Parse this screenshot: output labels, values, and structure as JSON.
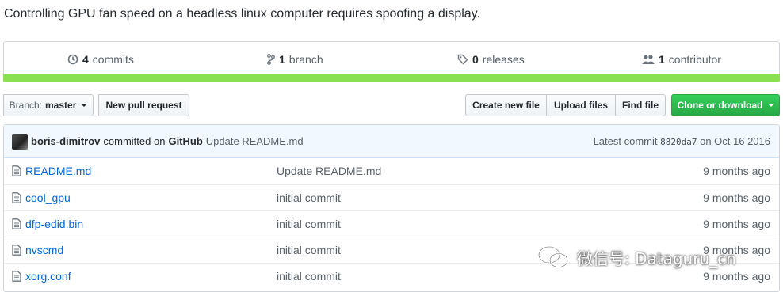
{
  "repo": {
    "description": "Controlling GPU fan speed on a headless linux computer requires spoofing a display."
  },
  "summary": {
    "commits_count": "4",
    "commits_label": "commits",
    "branch_count": "1",
    "branch_label": "branch",
    "releases_count": "0",
    "releases_label": "releases",
    "contributor_count": "1",
    "contributor_label": "contributor",
    "language_color": "#89e051"
  },
  "toolbar": {
    "branch_prefix": "Branch:",
    "branch_name": "master",
    "new_pull_request": "New pull request",
    "create_new_file": "Create new file",
    "upload_files": "Upload files",
    "find_file": "Find file",
    "clone_or_download": "Clone or download",
    "clone_color": "#28a745"
  },
  "latest_commit": {
    "author": "boris-dimitrov",
    "committed_on": "committed on",
    "platform": "GitHub",
    "message": "Update README.md",
    "latest_label": "Latest commit",
    "sha": "8820da7",
    "date": "on Oct 16 2016"
  },
  "files": [
    {
      "name": "README.md",
      "message": "Update README.md",
      "age": "9 months ago",
      "icon": "file-icon"
    },
    {
      "name": "cool_gpu",
      "message": "initial commit",
      "age": "9 months ago",
      "icon": "file-icon"
    },
    {
      "name": "dfp-edid.bin",
      "message": "initial commit",
      "age": "9 months ago",
      "icon": "file-icon"
    },
    {
      "name": "nvscmd",
      "message": "initial commit",
      "age": "9 months ago",
      "icon": "file-icon"
    },
    {
      "name": "xorg.conf",
      "message": "initial commit",
      "age": "9 months ago",
      "icon": "file-icon"
    }
  ],
  "watermark": {
    "text": "微信号: Dataguru_cn"
  }
}
